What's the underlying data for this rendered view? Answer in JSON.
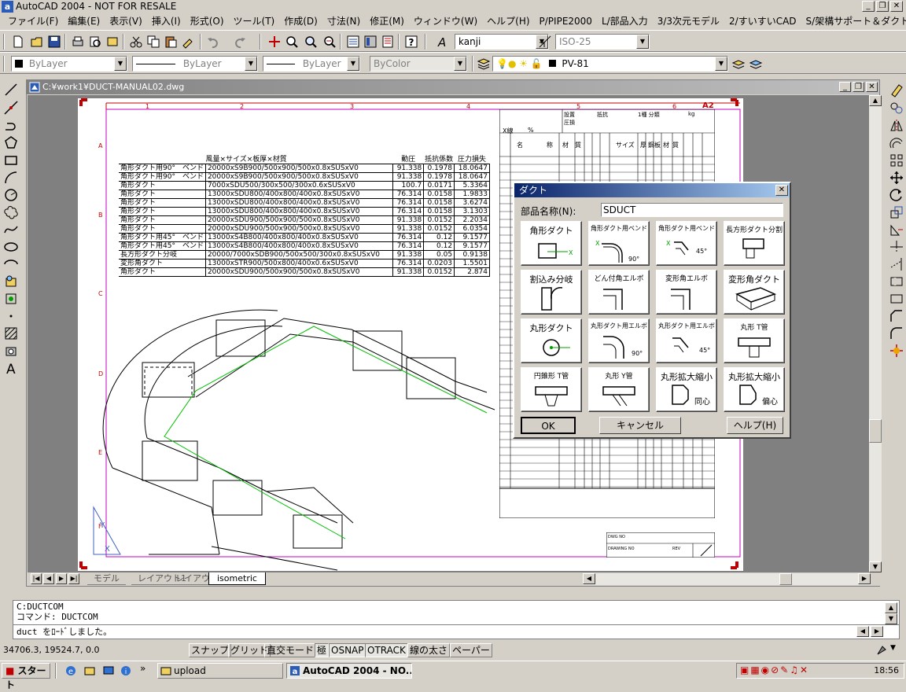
{
  "window": {
    "title": "AutoCAD 2004 - NOT FOR RESALE",
    "minimize": "_",
    "maximize": "❐",
    "close": "✕"
  },
  "menu": [
    "ファイル(F)",
    "編集(E)",
    "表示(V)",
    "挿入(I)",
    "形式(O)",
    "ツール(T)",
    "作成(D)",
    "寸法(N)",
    "修正(M)",
    "ウィンドウ(W)",
    "ヘルプ(H)",
    "P/PIPE2000",
    "L/部品入力",
    "3/3次元モデル",
    "2/すいすいCAD",
    "S/架構サポート＆ダクト設計"
  ],
  "toolbar1": {
    "text_style": "kanji",
    "dim_style": "ISO-25"
  },
  "toolbar2": {
    "color": "ByLayer",
    "linetype": "ByLayer",
    "lineweight": "ByLayer",
    "plotstyle": "ByColor",
    "layer": "PV-81"
  },
  "drawing": {
    "title": "C:¥work1¥DUCT-MANUAL02.dwg",
    "sheet_label": "A2",
    "columns": [
      "1",
      "2",
      "3",
      "4",
      "5",
      "6"
    ],
    "rows": [
      "A",
      "B",
      "C",
      "D",
      "E",
      "F"
    ],
    "table_headers": [
      "風量×サイズ×板厚×材質",
      "動圧",
      "抵抗係数",
      "圧力損失"
    ],
    "table_rows": [
      [
        "角形ダクト用90°　ベンド",
        "20000xS9B900/500x900/500x0.8xSUSxV0",
        "91.338",
        "0.1978",
        "18.0647"
      ],
      [
        "角形ダクト用90°　ベンド",
        "20000xS9B900/500x900/500x0.8xSUSxV0",
        "91.338",
        "0.1978",
        "18.0647"
      ],
      [
        "角形ダクト",
        "7000xSDU500/300x500/300x0.6xSUSxV0",
        "100.7",
        "0.0171",
        "5.3364"
      ],
      [
        "角形ダクト",
        "13000xSDU800/400x800/400x0.8xSUSxV0",
        "76.314",
        "0.0158",
        "1.9833"
      ],
      [
        "角形ダクト",
        "13000xSDU800/400x800/400x0.8xSUSxV0",
        "76.314",
        "0.0158",
        "3.6274"
      ],
      [
        "角形ダクト",
        "13000xSDU800/400x800/400x0.8xSUSxV0",
        "76.314",
        "0.0158",
        "3.1303"
      ],
      [
        "角形ダクト",
        "20000xSDU900/500x900/500x0.8xSUSxV0",
        "91.338",
        "0.0152",
        "2.2034"
      ],
      [
        "角形ダクト",
        "20000xSDU900/500x900/500x0.8xSUSxV0",
        "91.338",
        "0.0152",
        "6.0354"
      ],
      [
        "角形ダクト用45°　ベンド",
        "13000xS4B800/400x800/400x0.8xSUSxV0",
        "76.314",
        "0.12",
        "9.1577"
      ],
      [
        "角形ダクト用45°　ベンド",
        "13000xS4B800/400x800/400x0.8xSUSxV0",
        "76.314",
        "0.12",
        "9.1577"
      ],
      [
        "長方形ダクト分岐",
        "20000/7000xSDB900/500x500/300x0.8xSUSxV0",
        "91.338",
        "0.05",
        "0.9138"
      ],
      [
        "変形角ダクト",
        "13000xSTR900/500x800/400x0.6xSUSxV0",
        "76.314",
        "0.0203",
        "1.5501"
      ],
      [
        "角形ダクト",
        "20000xSDU900/500x900/500x0.8xSUSxV0",
        "91.338",
        "0.0152",
        "2.874"
      ]
    ],
    "list_header": [
      "X線",
      "%",
      "名",
      "称",
      "材",
      "質",
      "サイズ",
      "厚",
      "鋼板",
      "材",
      "質"
    ],
    "list_top": [
      "設置",
      "圧損",
      "抵抗",
      "1種 分類",
      "kg"
    ],
    "title_block": [
      "DWG NO",
      "DRAWING NO",
      "REV"
    ]
  },
  "layout_tabs": [
    "モデル",
    "レイアウト1",
    "レイアウト2",
    "isometric"
  ],
  "dialog": {
    "title": "ダクト",
    "part_name_label": "部品名称(N):",
    "part_name_value": "SDUCT",
    "parts": [
      "角形ダクト",
      "角形ダクト用ベンド",
      "角形ダクト用ベンド",
      "長方形ダクト分割",
      "割込み分岐",
      "どん付角エルボ",
      "変形角エルボ",
      "変形角ダクト",
      "丸形ダクト",
      "丸形ダクト用エルボ",
      "丸形ダクト用エルボ",
      "丸形 T管",
      "円錐形 T管",
      "丸形 Y管",
      "丸形拡大縮小",
      "丸形拡大縮小"
    ],
    "part_notes": [
      "90°",
      "45°",
      "90°",
      "45°",
      "同心",
      "偏心"
    ],
    "ok": "OK",
    "cancel": "キャンセル",
    "help": "ヘルプ(H)"
  },
  "command": {
    "line1": "C:DUCTCOM",
    "line2": "コマンド: DUCTCOM",
    "line3": "duct をﾛｰﾄﾞしました。"
  },
  "status": {
    "coords": "34706.3, 19524.7, 0.0",
    "buttons": [
      "スナップ",
      "グリッド",
      "直交モード",
      "極",
      "OSNAP",
      "OTRACK",
      "線の太さ",
      "ペーパー"
    ]
  },
  "taskbar": {
    "start": "スタート",
    "tasks": [
      "upload",
      "AutoCAD 2004 - NO..."
    ],
    "clock": "18:56"
  }
}
